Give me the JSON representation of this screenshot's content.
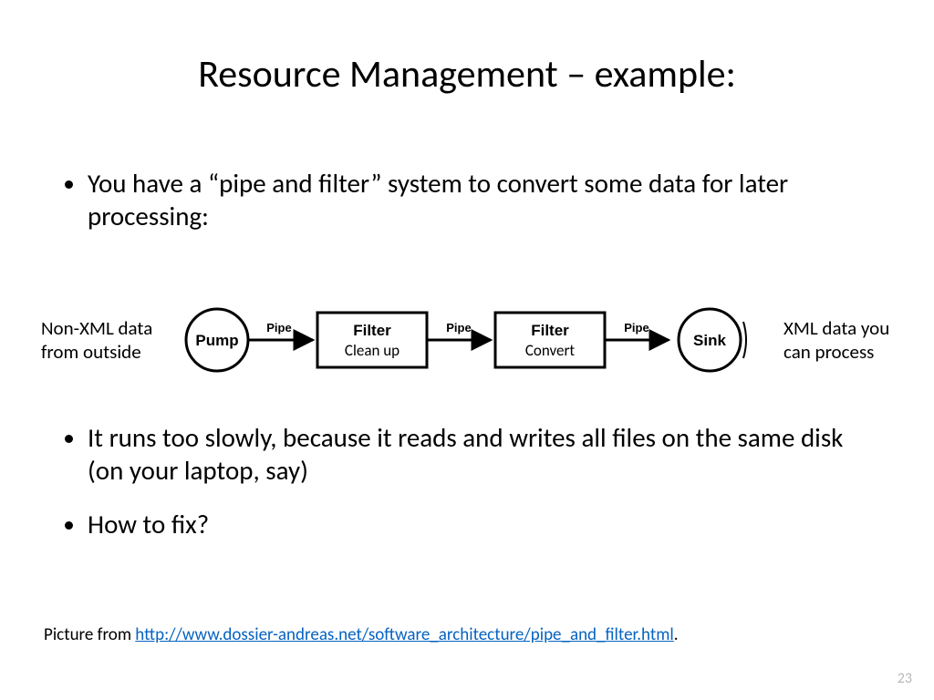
{
  "title": "Resource Management – example:",
  "bullets": {
    "b1": "You have a “pipe and filter” system to convert some data for later processing:",
    "b2": "It runs too slowly, because it reads and writes all files on the same disk (on your laptop, say)",
    "b3": "How to fix?"
  },
  "diagram": {
    "left_label": "Non-XML data from outside",
    "right_label": "XML data you can process",
    "pump": "Pump",
    "sink": "Sink",
    "filter": "Filter",
    "filter1_sub": "Clean up",
    "filter2_sub": "Convert",
    "pipe": "Pipe"
  },
  "credit": {
    "prefix": "Picture from ",
    "url_text": "http://www.dossier-andreas.net/software_architecture/pipe_and_filter.html",
    "url_href": "http://www.dossier-andreas.net/software_architecture/pipe_and_filter.html",
    "suffix": "."
  },
  "page_number": "23"
}
